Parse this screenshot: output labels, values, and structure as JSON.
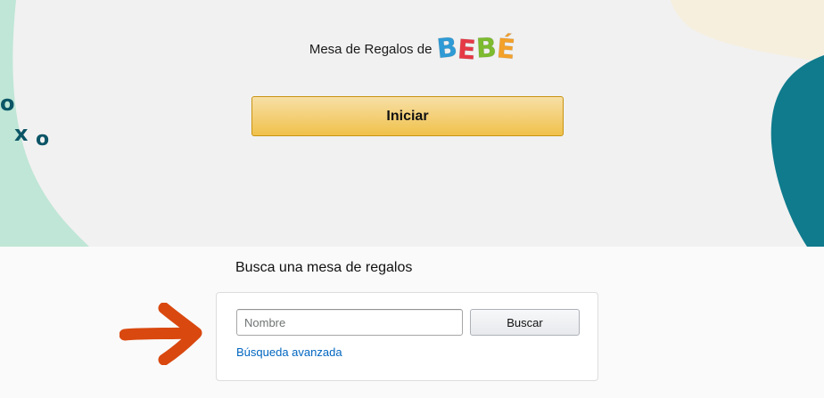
{
  "hero": {
    "brand_prefix": "Mesa de Regalos de",
    "brand_logo_letters": [
      {
        "char": "B",
        "color": "#2e9bd6"
      },
      {
        "char": "E",
        "color": "#e63946"
      },
      {
        "char": "B",
        "color": "#7dbb2f"
      },
      {
        "char": "É",
        "color": "#f4a12a"
      }
    ],
    "start_button_label": "Iniciar",
    "decoration_text": [
      "o",
      "x",
      "o"
    ]
  },
  "search": {
    "title": "Busca una mesa de regalos",
    "name_placeholder": "Nombre",
    "name_value": "",
    "search_button_label": "Buscar",
    "advanced_link_label": "Búsqueda avanzada"
  },
  "colors": {
    "hero_background": "#f1f1f1",
    "mint_blob": "#bfe6d6",
    "teal_blob": "#0f7b8d",
    "cream_blob": "#f6efde",
    "start_button": "#f0c14b",
    "link": "#0066c0",
    "annotation_arrow": "#d9480f"
  },
  "annotation": {
    "icon": "arrow-right-icon"
  }
}
